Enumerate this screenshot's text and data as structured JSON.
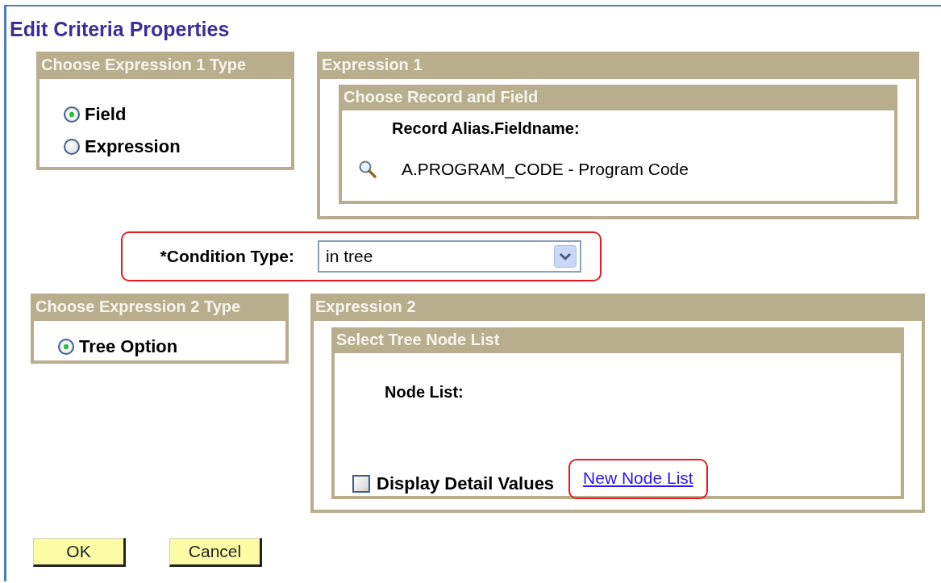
{
  "page": {
    "title": "Edit Criteria Properties"
  },
  "expression1_type": {
    "title": "Choose Expression 1 Type",
    "options": [
      {
        "label": "Field",
        "selected": true
      },
      {
        "label": "Expression",
        "selected": false
      }
    ]
  },
  "expression1": {
    "title": "Expression 1",
    "record_field": {
      "title": "Choose Record and Field",
      "label": "Record Alias.Fieldname:",
      "value": "A.PROGRAM_CODE - Program Code"
    }
  },
  "condition_type": {
    "label": "*Condition Type:",
    "value": "in tree"
  },
  "expression2_type": {
    "title": "Choose Expression 2 Type",
    "options": [
      {
        "label": "Tree Option",
        "selected": true
      }
    ]
  },
  "expression2": {
    "title": "Expression 2",
    "node_list": {
      "title": "Select Tree Node List",
      "label": "Node List:",
      "display_detail_values": {
        "label": "Display Detail Values",
        "checked": false
      },
      "link": "New Node List"
    }
  },
  "buttons": [
    "OK",
    "Cancel"
  ]
}
